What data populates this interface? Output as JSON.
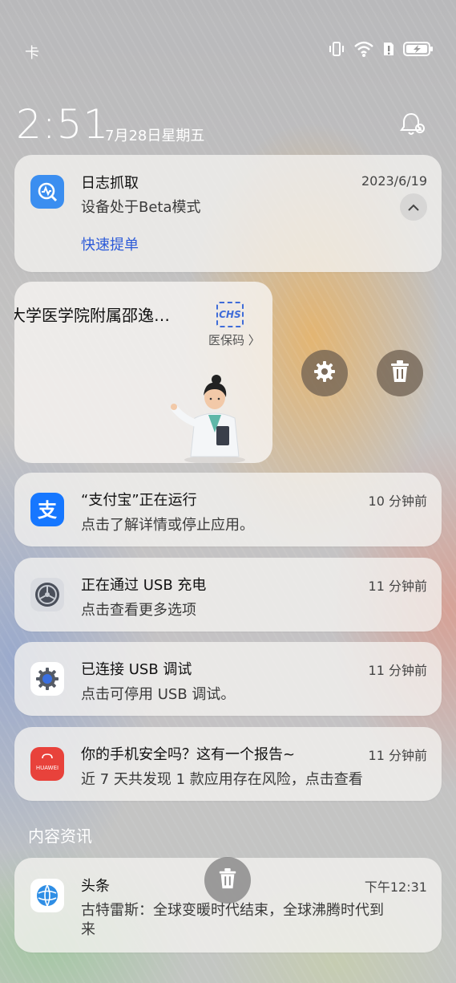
{
  "status_bar": {
    "sim_label": "卡",
    "icons": [
      "vibrate-icon",
      "wifi-icon",
      "alert-sim-icon",
      "battery-charging-icon"
    ]
  },
  "lockscreen": {
    "time": "2:51",
    "date": "7月28日星期五"
  },
  "notifications": [
    {
      "app_icon": "log-capture-icon",
      "title": "日志抓取",
      "body": "设备处于Beta模式",
      "time": "2023/6/19",
      "action": "快速提单"
    },
    {
      "app_icon": "alipay-icon",
      "title": "“支付宝”正在运行",
      "body": "点击了解详情或停止应用。",
      "time": "10 分钟前"
    },
    {
      "app_icon": "settings-icon",
      "title": "正在通过 USB 充电",
      "body": "点击查看更多选项",
      "time": "11 分钟前"
    },
    {
      "app_icon": "gear-icon",
      "title": "已连接 USB 调试",
      "body": "点击可停用 USB 调试。",
      "time": "11 分钟前"
    },
    {
      "app_icon": "huawei-icon",
      "title": "你的手机安全吗？这有一个报告~",
      "body": "近 7 天共发现 1 款应用存在风险，点击查看",
      "time": "11 分钟前"
    }
  ],
  "widget": {
    "title": "大学医学院附属邵逸…",
    "badge": "CHS",
    "badge_label": "医保码 〉"
  },
  "content_section": {
    "header": "内容资讯",
    "item": {
      "app_icon": "toutiao-icon",
      "title": "头条",
      "body_line1": "古特雷斯：全球变暖时代结束，全球沸腾时代到",
      "body_line2": "来",
      "time": "下午12:31"
    }
  },
  "colors": {
    "accent_blue": "#2d5bd8",
    "alipay_blue": "#1677ff",
    "huawei_red": "#e8423b"
  }
}
